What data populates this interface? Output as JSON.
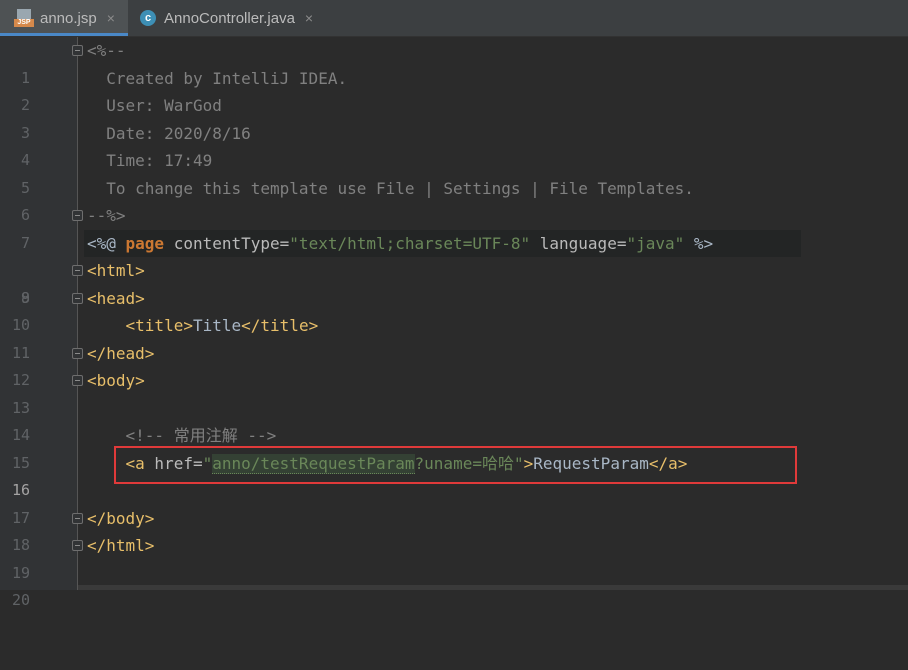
{
  "tabs": [
    {
      "label": "anno.jsp",
      "icon": "jsp-file-icon",
      "active": true
    },
    {
      "label": "AnnoController.java",
      "icon": "java-class-icon",
      "active": false
    }
  ],
  "tab_close_glyph": "×",
  "class_icon_letter": "c",
  "jsp_icon_text": "JSP",
  "current_line": 16,
  "lines": {
    "l1": "<%--",
    "l2": "  Created by IntelliJ IDEA.",
    "l3": "  User: WarGod",
    "l4": "  Date: 2020/8/16",
    "l5": "  Time: 17:49",
    "l6": "  To change this template use File | Settings | File Templates.",
    "l7": "--%>",
    "l8": {
      "open": "<%@ ",
      "kw": "page",
      "attr1": " contentType=",
      "val1": "\"text/html;charset=UTF-8\"",
      "attr2": " language=",
      "val2": "\"java\"",
      "close": " %>"
    },
    "l9": "<html>",
    "l10": "<head>",
    "l11": {
      "indent": "    ",
      "open": "<title>",
      "text": "Title",
      "close": "</title>"
    },
    "l12": "</head>",
    "l13": "<body>",
    "l15": "    <!-- 常用注解 -->",
    "l16": {
      "indent": "    ",
      "open": "<a",
      "attr": " href=",
      "q1": "\"",
      "url": "anno/testRequestParam",
      "query": "?uname=哈哈\"",
      "gt": ">",
      "text": "RequestParam",
      "close": "</a>"
    },
    "l18": "</body>",
    "l19": "</html>"
  }
}
